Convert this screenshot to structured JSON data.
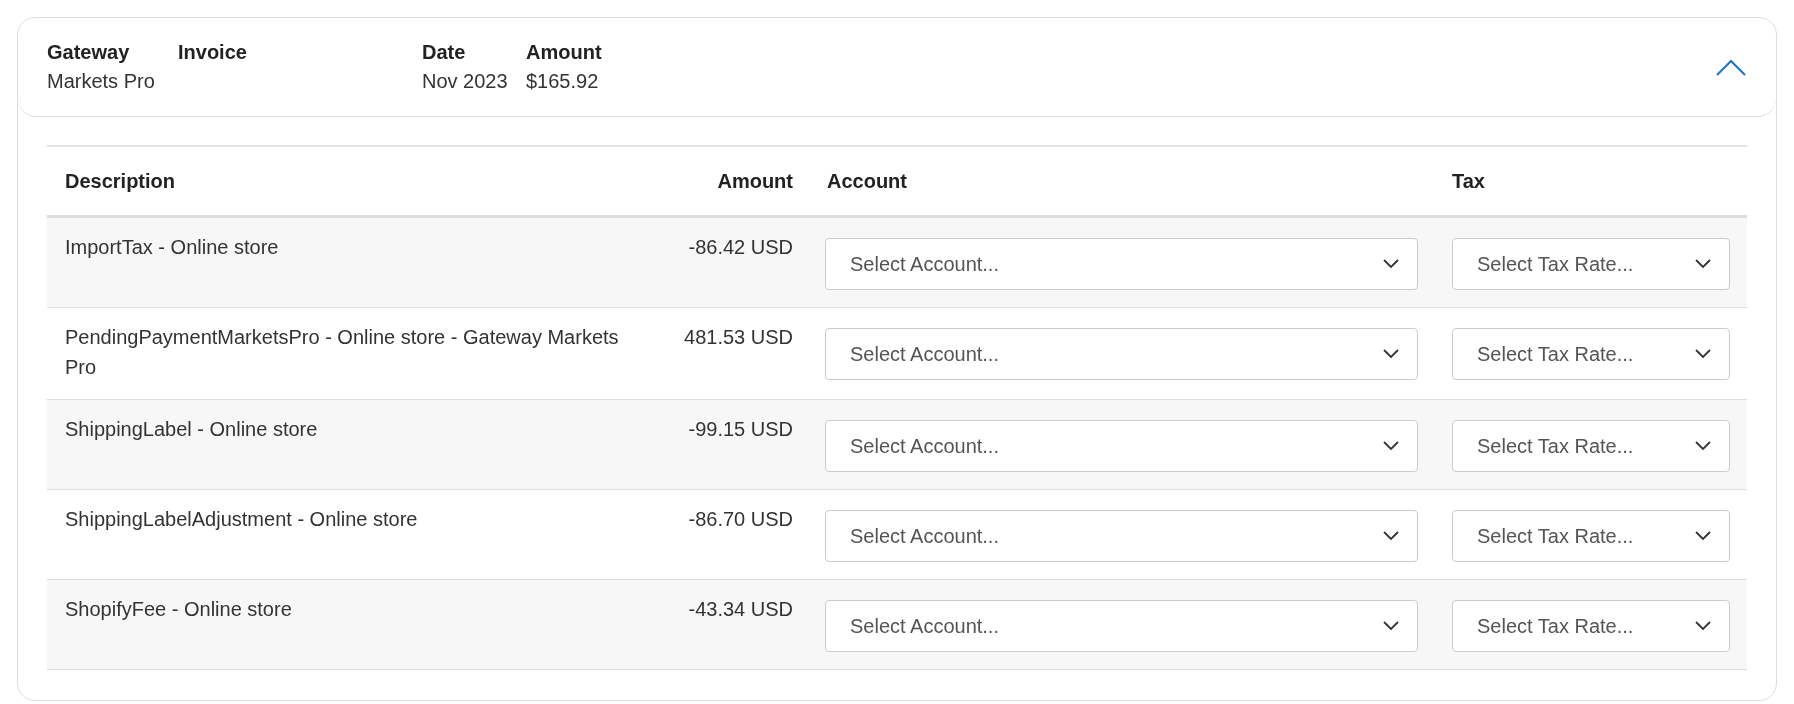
{
  "summary": {
    "fields": [
      {
        "label": "Gateway",
        "value": "Markets Pro"
      },
      {
        "label": "Invoice"
      },
      {
        "label": "Date",
        "value": "Nov 2023"
      },
      {
        "label": "Amount",
        "value": "$165.92"
      }
    ],
    "expanded": true
  },
  "table": {
    "columns": [
      "Description",
      "Amount",
      "Account",
      "Tax"
    ],
    "rows": [
      {
        "description": "ImportTax - Online store",
        "amount": "-86.42 USD",
        "account": {
          "placeholder": "Select Account..."
        },
        "tax": {
          "placeholder": "Select Tax Rate..."
        }
      },
      {
        "description": "PendingPaymentMarketsPro - Online store - Gateway Markets Pro",
        "amount": "481.53 USD",
        "account": {
          "placeholder": "Select Account..."
        },
        "tax": {
          "placeholder": "Select Tax Rate..."
        }
      },
      {
        "description": "ShippingLabel - Online store",
        "amount": "-99.15 USD",
        "account": {
          "placeholder": "Select Account..."
        },
        "tax": {
          "placeholder": "Select Tax Rate..."
        }
      },
      {
        "description": "ShippingLabelAdjustment - Online store",
        "amount": "-86.70 USD",
        "account": {
          "placeholder": "Select Account..."
        },
        "tax": {
          "placeholder": "Select Tax Rate..."
        }
      },
      {
        "description": "ShopifyFee - Online store",
        "amount": "-43.34 USD",
        "account": {
          "placeholder": "Select Account..."
        },
        "tax": {
          "placeholder": "Select Tax Rate..."
        }
      }
    ]
  }
}
